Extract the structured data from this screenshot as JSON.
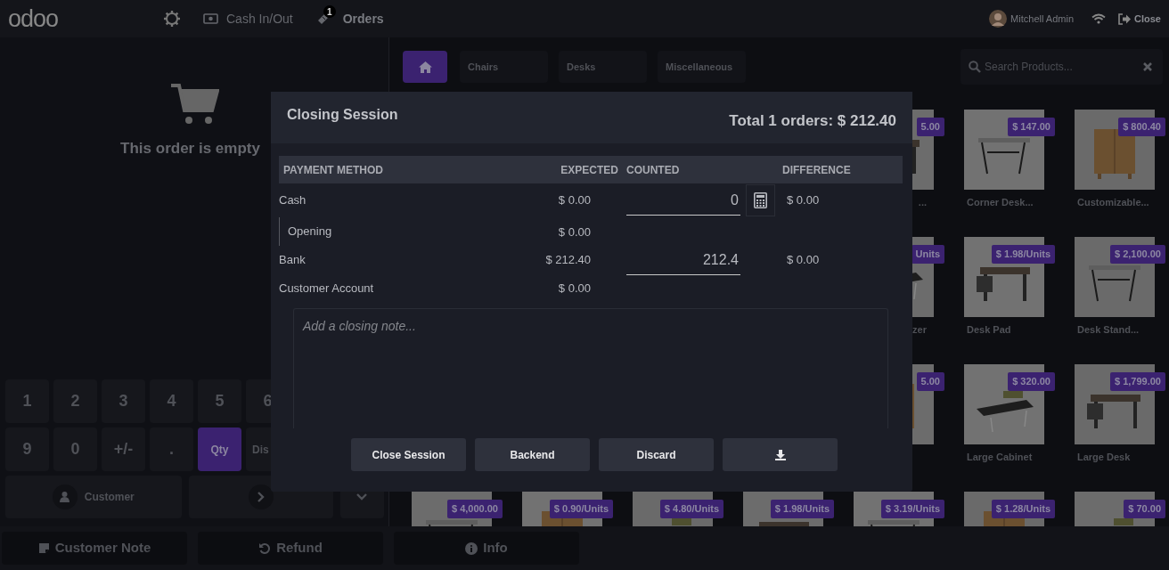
{
  "header": {
    "logo": "odoo",
    "nav": [
      {
        "kind": "settings"
      },
      {
        "kind": "cash",
        "label": "Cash In/Out"
      },
      {
        "kind": "orders",
        "label": "Orders",
        "badge": "1"
      }
    ],
    "user": {
      "name": "Mitchell Admin"
    },
    "close": {
      "label": "Close"
    }
  },
  "order": {
    "empty_message": "This order is empty"
  },
  "numpad": [
    [
      {
        "label": "1",
        "selected": false
      },
      {
        "label": "2",
        "selected": false
      },
      {
        "label": "3",
        "selected": false
      },
      {
        "label": "4",
        "selected": false
      },
      {
        "label": "5",
        "selected": false
      },
      {
        "label": "6",
        "selected": false
      }
    ],
    [
      {
        "label": "9",
        "selected": false
      },
      {
        "label": "0",
        "selected": false
      },
      {
        "label": "+/-",
        "selected": false
      },
      {
        "label": ".",
        "selected": false
      },
      {
        "label": "Qty",
        "selected": true
      },
      {
        "label": "Dis",
        "selected": false
      }
    ]
  ],
  "customer_button": {
    "label": "Customer"
  },
  "footer_buttons": [
    {
      "kind": "note",
      "label": "Customer Note"
    },
    {
      "kind": "refund",
      "label": "Refund"
    },
    {
      "kind": "info",
      "label": "Info"
    }
  ],
  "categories": [
    {
      "kind": "home",
      "selected": true
    },
    {
      "kind": "text",
      "label": "Chairs",
      "selected": false
    },
    {
      "kind": "text",
      "label": "Desks",
      "selected": false
    },
    {
      "kind": "text",
      "label": "Miscellaneous",
      "selected": false
    }
  ],
  "search": {
    "placeholder": "Search Products..."
  },
  "product_rows": [
    {
      "items": [
        {
          "price": "5.00",
          "name": "..."
        },
        {
          "price": "$ 147.00",
          "name": "Corner Desk..."
        },
        {
          "price": "$ 800.40",
          "name": "Customizable..."
        }
      ]
    },
    {
      "items": [
        {
          "price": "Units",
          "name": "zer"
        },
        {
          "price": "$ 1.98/Units",
          "name": "Desk Pad"
        },
        {
          "price": "$ 2,100.00",
          "name": "Desk Stand..."
        }
      ]
    },
    {
      "items": [
        {
          "price": "5.00"
        },
        {
          "price": "$ 320.00",
          "name": "Large Cabinet"
        },
        {
          "price": "$ 1,799.00",
          "name": "Large Desk"
        }
      ]
    },
    {
      "items": [
        {
          "price": "$ 4,000.00"
        },
        {
          "price": "$ 0.90/Units"
        },
        {
          "price": "$ 4.80/Units"
        },
        {
          "price": "$ 1.98/Units"
        },
        {
          "price": "$ 3.19/Units"
        },
        {
          "price": "$ 1.28/Units"
        },
        {
          "price": "$ 70.00"
        }
      ]
    }
  ],
  "closing_session": {
    "title": "Closing Session",
    "total": "Total 1 orders: $ 212.40",
    "columns": [
      "PAYMENT METHOD",
      "EXPECTED",
      "COUNTED",
      "DIFFERENCE"
    ],
    "rows": [
      {
        "kind": "counted_with_calculator",
        "method": "Cash",
        "expected": "$ 0.00",
        "counted": "0",
        "difference": "$ 0.00"
      },
      {
        "kind": "sub",
        "method": "Opening",
        "expected": "$ 0.00"
      },
      {
        "kind": "counted",
        "method": "Bank",
        "expected": "$ 212.40",
        "counted": "212.4",
        "difference": "$ 0.00"
      },
      {
        "kind": "plain",
        "method": "Customer Account",
        "expected": "$ 0.00"
      }
    ],
    "note": {
      "placeholder": "Add a closing note..."
    },
    "buttons": [
      {
        "kind": "text",
        "label": "Close Session"
      },
      {
        "kind": "text",
        "label": "Backend"
      },
      {
        "kind": "text",
        "label": "Discard"
      },
      {
        "kind": "download"
      }
    ]
  }
}
